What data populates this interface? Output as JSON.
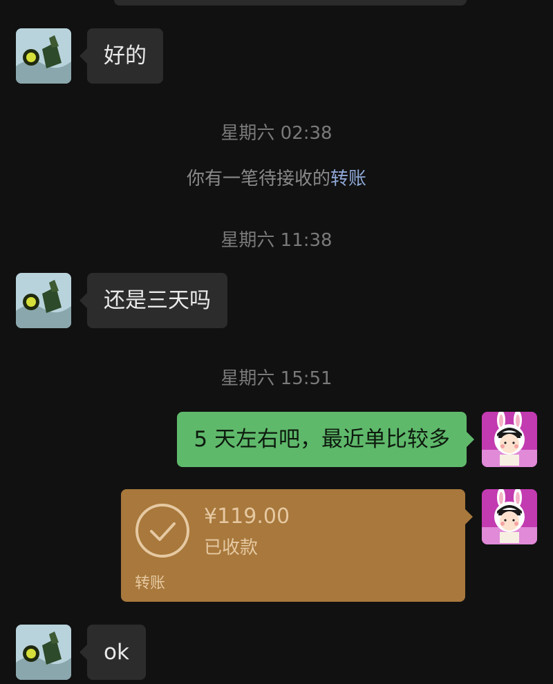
{
  "chat": {
    "timestamps": {
      "t1": "星期六 02:38",
      "t2": "星期六 11:38",
      "t3": "星期六 15:51"
    },
    "system_notice": {
      "prefix": "你有一笔待接收的",
      "link": "转账"
    },
    "messages": {
      "m1": {
        "sender": "contact",
        "text": "好的"
      },
      "m2": {
        "sender": "contact",
        "text": "还是三天吗"
      },
      "m3": {
        "sender": "self",
        "text": "5 天左右吧，最近单比较多"
      },
      "m5": {
        "sender": "contact",
        "text": "ok"
      }
    },
    "transfer": {
      "amount": "¥119.00",
      "status": "已收款",
      "footer": "转账"
    }
  },
  "icons": {
    "contact_avatar": "contact-avatar-icon",
    "self_avatar": "self-avatar-icon",
    "transfer_check": "check-circle-icon"
  },
  "colors": {
    "background": "#111111",
    "incoming_bubble": "#2c2c2c",
    "outgoing_bubble": "#5fb96b",
    "transfer_card": "#a8783c",
    "link": "#8fa8d6"
  }
}
